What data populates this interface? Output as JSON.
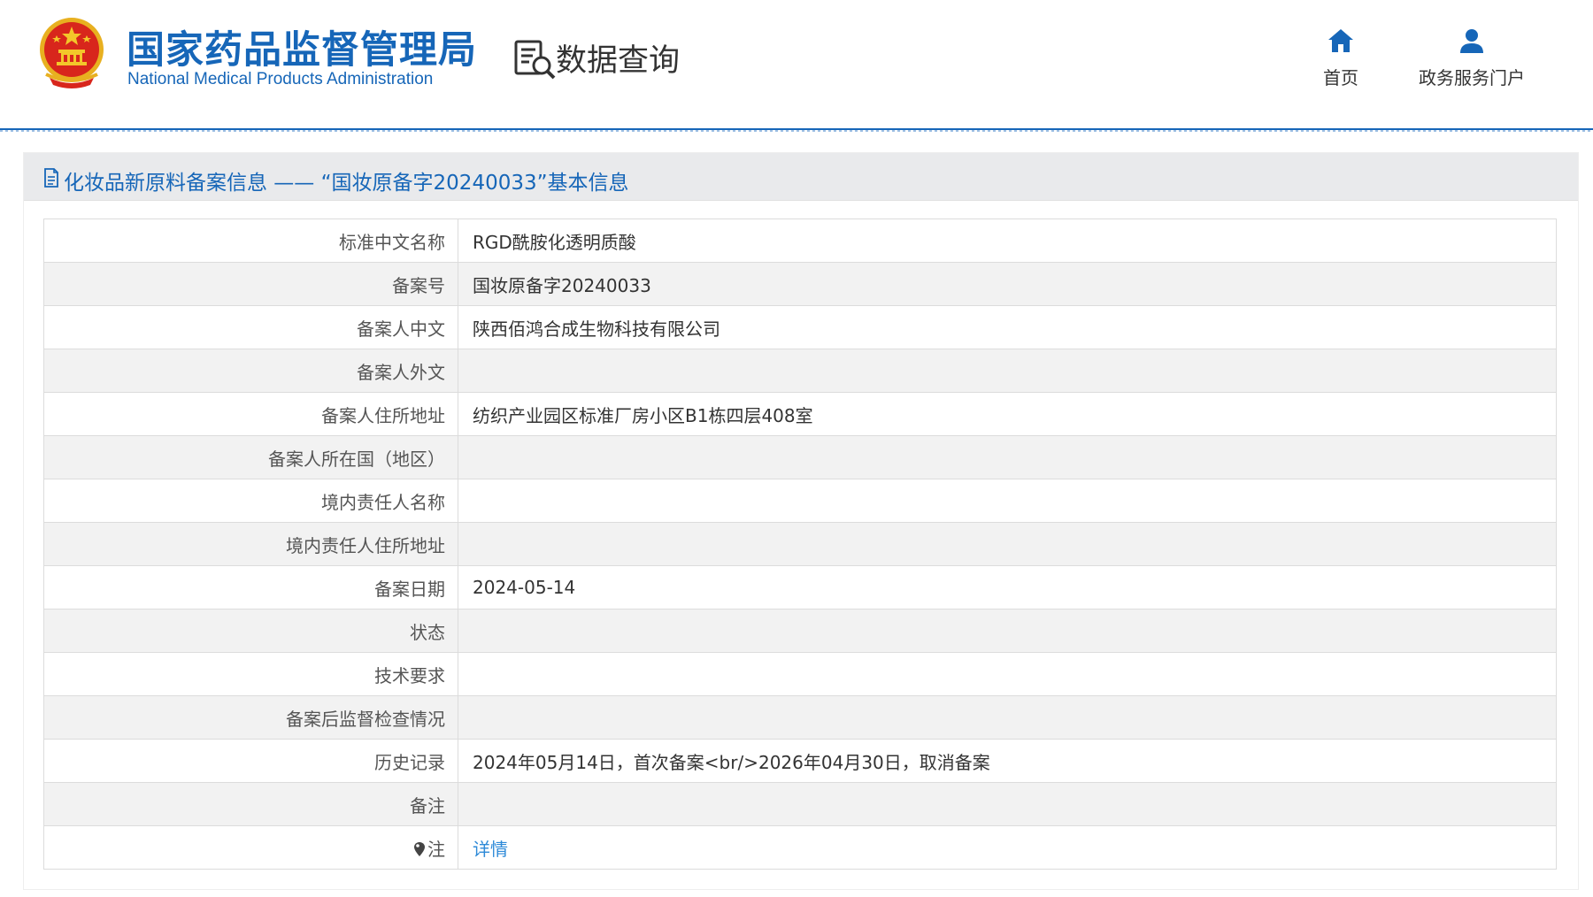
{
  "header": {
    "agency_cn": "国家药品监督管理局",
    "agency_en": "National Medical Products Administration",
    "section_title": "数据查询",
    "nav": [
      {
        "label": "首页",
        "icon": "home-icon"
      },
      {
        "label": "政务服务门户",
        "icon": "user-icon"
      }
    ]
  },
  "panel": {
    "title": "化妆品新原料备案信息 —— “国妆原备字20240033”基本信息",
    "icon": "document-icon"
  },
  "rows": [
    {
      "label": "标准中文名称",
      "value": "RGD酰胺化透明质酸"
    },
    {
      "label": "备案号",
      "value": "国妆原备字20240033"
    },
    {
      "label": "备案人中文",
      "value": "陕西佰鸿合成生物科技有限公司"
    },
    {
      "label": "备案人外文",
      "value": ""
    },
    {
      "label": "备案人住所地址",
      "value": "纺织产业园区标准厂房小区B1栋四层408室"
    },
    {
      "label": "备案人所在国（地区）",
      "value": ""
    },
    {
      "label": "境内责任人名称",
      "value": ""
    },
    {
      "label": "境内责任人住所地址",
      "value": ""
    },
    {
      "label": "备案日期",
      "value": "2024-05-14"
    },
    {
      "label": "状态",
      "value": ""
    },
    {
      "label": "技术要求",
      "value": ""
    },
    {
      "label": "备案后监督检查情况",
      "value": ""
    },
    {
      "label": "历史记录",
      "value": "2024年05月14日，首次备案<br/>2026年04月30日，取消备案"
    },
    {
      "label": "备注",
      "value": ""
    }
  ],
  "note_row": {
    "label": "注",
    "icon": "pin-icon",
    "link": "详情"
  },
  "colors": {
    "brand_blue": "#1666b8",
    "link_blue": "#2e8ad8",
    "stripe": "#f2f2f2",
    "title_bar": "#e9eaec"
  }
}
